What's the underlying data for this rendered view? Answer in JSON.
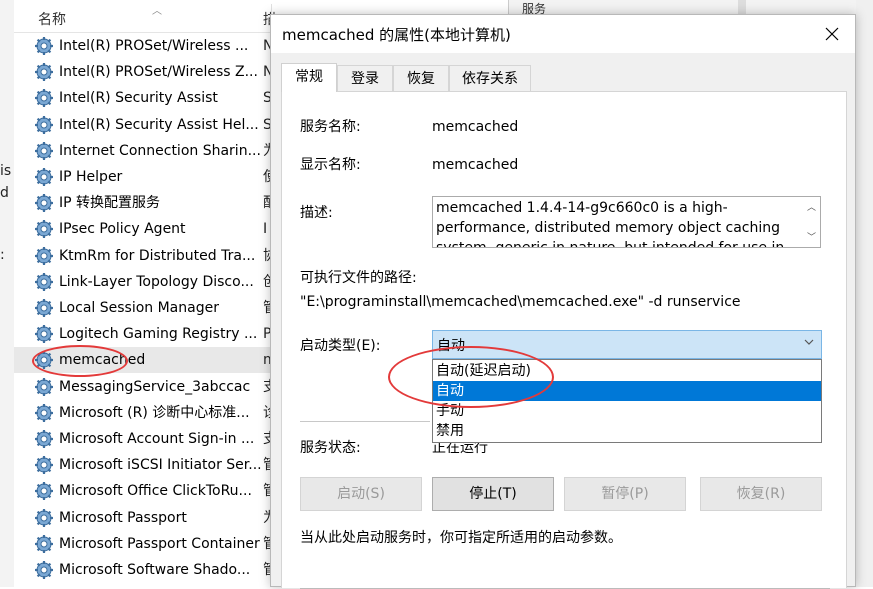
{
  "edge_fragments": [
    "is",
    "d",
    ":"
  ],
  "list": {
    "header": {
      "name": "名称",
      "next_col": "描"
    },
    "rows": [
      {
        "name": "Intel(R) PROSet/Wireless ...",
        "next": "N"
      },
      {
        "name": "Intel(R) PROSet/Wireless Z...",
        "next": "N"
      },
      {
        "name": "Intel(R) Security Assist",
        "next": "S"
      },
      {
        "name": "Intel(R) Security Assist Hel...",
        "next": "S"
      },
      {
        "name": "Internet Connection Sharin...",
        "next": "为"
      },
      {
        "name": "IP Helper",
        "next": "使"
      },
      {
        "name": "IP 转换配置服务",
        "next": "配"
      },
      {
        "name": "IPsec Policy Agent",
        "next": "I"
      },
      {
        "name": "KtmRm for Distributed Tra...",
        "next": "协"
      },
      {
        "name": "Link-Layer Topology Disco...",
        "next": "创"
      },
      {
        "name": "Local Session Manager",
        "next": "管"
      },
      {
        "name": "Logitech Gaming Registry ...",
        "next": "P"
      },
      {
        "name": "memcached",
        "next": "m"
      },
      {
        "name": "MessagingService_3abccac",
        "next": "支"
      },
      {
        "name": "Microsoft (R) 诊断中心标准...",
        "next": "诊"
      },
      {
        "name": "Microsoft Account Sign-in ...",
        "next": "支"
      },
      {
        "name": "Microsoft iSCSI Initiator Ser...",
        "next": "管"
      },
      {
        "name": "Microsoft Office ClickToRu...",
        "next": "管"
      },
      {
        "name": "Microsoft Passport",
        "next": "为"
      },
      {
        "name": "Microsoft Passport Container",
        "next": "管"
      },
      {
        "name": "Microsoft Software Shado...",
        "next": "管"
      }
    ],
    "selected_index": 12
  },
  "background_right": {
    "header_label": "服务"
  },
  "dialog": {
    "title": "memcached 的属性(本地计算机)",
    "tabs": [
      "常规",
      "登录",
      "恢复",
      "依存关系"
    ],
    "active_tab": 0,
    "service_name_label": "服务名称:",
    "service_name_value": "memcached",
    "display_name_label": "显示名称:",
    "display_name_value": "memcached",
    "description_label": "描述:",
    "description_value": "memcached 1.4.4-14-g9c660c0 is a high-performance, distributed memory object caching system, generic in nature, but intended for use in",
    "exe_path_label": "可执行文件的路径:",
    "exe_path_value": "\"E:\\programinstall\\memcached\\memcached.exe\" -d runservice",
    "startup_type_label": "启动类型(E):",
    "startup_type_value": "自动",
    "startup_options": [
      "自动(延迟启动)",
      "自动",
      "手动",
      "禁用"
    ],
    "startup_highlighted": 1,
    "status_label": "服务状态:",
    "status_value": "正在运行",
    "buttons": [
      {
        "label": "启动(S)",
        "enabled": false
      },
      {
        "label": "停止(T)",
        "enabled": true
      },
      {
        "label": "暂停(P)",
        "enabled": false
      },
      {
        "label": "恢复(R)",
        "enabled": false
      }
    ],
    "start_params_hint": "当从此处启动服务时，你可指定所适用的启动参数。"
  },
  "colors": {
    "highlight": "#0078d7",
    "combo_focus": "#cce4f7",
    "annotation": "#e33a3a",
    "dialog_bg": "#f0f0f0"
  },
  "icons": [
    "gear-icon",
    "close-icon",
    "chevron-down-icon",
    "sort-up-icon"
  ]
}
